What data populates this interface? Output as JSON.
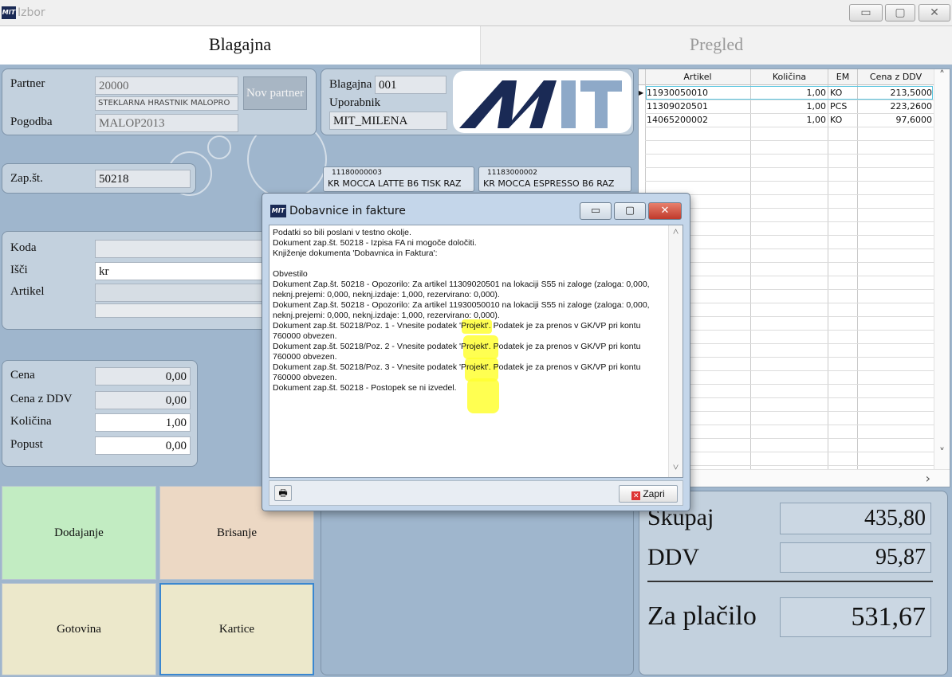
{
  "window": {
    "title": "Izbor",
    "logo": "MIT",
    "min": "▭",
    "max": "▢",
    "close": "✕"
  },
  "tabs": [
    {
      "label": "Blagajna"
    },
    {
      "label": "Pregled"
    }
  ],
  "partner": {
    "partner_label": "Partner",
    "partner_code": "20000",
    "partner_name": "STEKLARNA HRASTNIK MALOPRO",
    "pogodba_label": "Pogodba",
    "pogodba_value": "MALOP2013",
    "new_partner_label": "Nov partner"
  },
  "register": {
    "blagajna_label": "Blagajna",
    "blagajna_value": "001",
    "user_label": "Uporabnik",
    "user_value": "MIT_MILENA",
    "logo_text": "MIT"
  },
  "doc": {
    "label": "Zap.št.",
    "value": "50218"
  },
  "quick_items": [
    {
      "code": "11180000003",
      "name": "KR MOCCA LATTE B6 TISK RAZ"
    },
    {
      "code": "11183000002",
      "name": "KR MOCCA ESPRESSO B6 RAZ"
    }
  ],
  "search": {
    "koda_label": "Koda",
    "isci_label": "Išči",
    "isci_value": "kr",
    "artikel_label": "Artikel"
  },
  "pricing": {
    "cena_label": "Cena",
    "cena_value": "0,00",
    "cena_ddv_label": "Cena z DDV",
    "cena_ddv_value": "0,00",
    "kolicina_label": "Količina",
    "kolicina_value": "1,00",
    "popust_label": "Popust",
    "popust_value": "0,00"
  },
  "actions": {
    "dodajanje": "Dodajanje",
    "brisanje": "Brisanje",
    "gotovina": "Gotovina",
    "kartice": "Kartice"
  },
  "grid": {
    "columns": [
      "Artikel",
      "Količina",
      "EM",
      "Cena z DDV"
    ],
    "rows": [
      [
        "11930050010",
        "1,00",
        "KO",
        "213,5000"
      ],
      [
        "11309020501",
        "1,00",
        "PCS",
        "223,2600"
      ],
      [
        "14065200002",
        "1,00",
        "KO",
        "97,6000"
      ]
    ],
    "row_marker": "▶",
    "scroll_up": "˄",
    "scroll_down": "˅",
    "scroll_right": "›"
  },
  "totals": {
    "skupaj_label": "Skupaj",
    "skupaj_value": "435,80",
    "ddv_label": "DDV",
    "ddv_value": "95,87",
    "zaplacilo_label": "Za plačilo",
    "zaplacilo_value": "531,67"
  },
  "dialog": {
    "title": "Dobavnice in fakture",
    "logo": "MIT",
    "min": "▭",
    "max": "▢",
    "close": "✕",
    "messages": "Podatki so bili poslani v testno okolje.\nDokument zap.št. 50218 - Izpisa FA ni mogoče določiti.\nKnjiženje dokumenta 'Dobavnica in Faktura':\n\nObvestilo\nDokument Zap.št. 50218 - Opozorilo: Za artikel 11309020501 na lokaciji S55 ni zaloge (zaloga: 0,000, neknj.prejemi: 0,000, neknj.izdaje: 1,000, rezervirano: 0,000).\nDokument Zap.št. 50218 - Opozorilo: Za artikel 11930050010 na lokaciji S55 ni zaloge (zaloga: 0,000, neknj.prejemi: 0,000, neknj.izdaje: 1,000, rezervirano: 0,000).\nDokument zap.št. 50218/Poz. 1 - Vnesite podatek 'Projekt'. Podatek je za prenos v GK/VP pri kontu 760000 obvezen.\nDokument zap.št. 50218/Poz. 2 - Vnesite podatek 'Projekt'. Podatek je za prenos v GK/VP pri kontu 760000 obvezen.\nDokument zap.št. 50218/Poz. 3 - Vnesite podatek 'Projekt'. Podatek je za prenos v GK/VP pri kontu 760000 obvezen.\nDokument zap.št. 50218 - Postopek se ni izvedel.",
    "print_icon": "🖶",
    "close_button": "Zapri",
    "close_icon": "✕",
    "scroll_up": "˄",
    "scroll_down": "˅"
  },
  "colors": {
    "background": "#9fb6cd",
    "panel": "#c3d1de",
    "dodajanje": "#c2ecc2",
    "brisanje": "#ecd8c4",
    "gotovina": "#ece8cb",
    "kartice": "#ece8cb",
    "logo_dark": "#1a2a55",
    "logo_light": "#8ea9c8",
    "highlight": "#ffff33"
  }
}
